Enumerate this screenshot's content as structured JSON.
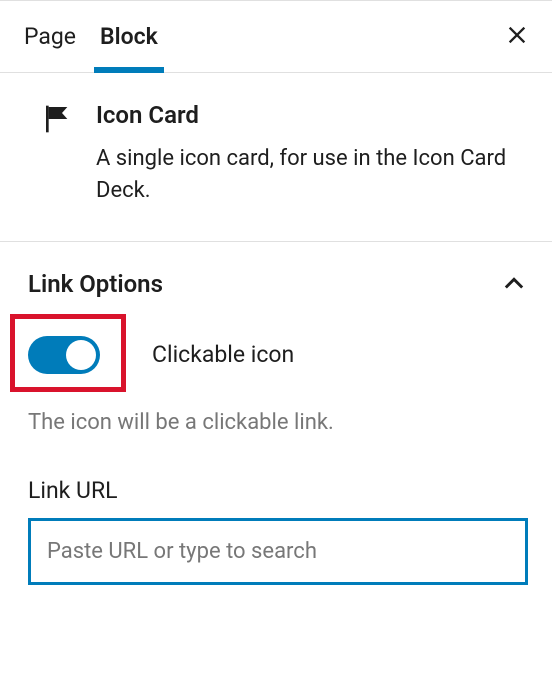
{
  "tabs": {
    "page": "Page",
    "block": "Block"
  },
  "block": {
    "title": "Icon Card",
    "description": "A single icon card, for use in the Icon Card Deck."
  },
  "section": {
    "title": "Link Options"
  },
  "toggle": {
    "label": "Clickable icon",
    "help": "The icon will be a clickable link.",
    "on": true
  },
  "url_field": {
    "label": "Link URL",
    "placeholder": "Paste URL or type to search",
    "value": ""
  },
  "colors": {
    "accent": "#007cba",
    "highlight": "#d9132c"
  }
}
